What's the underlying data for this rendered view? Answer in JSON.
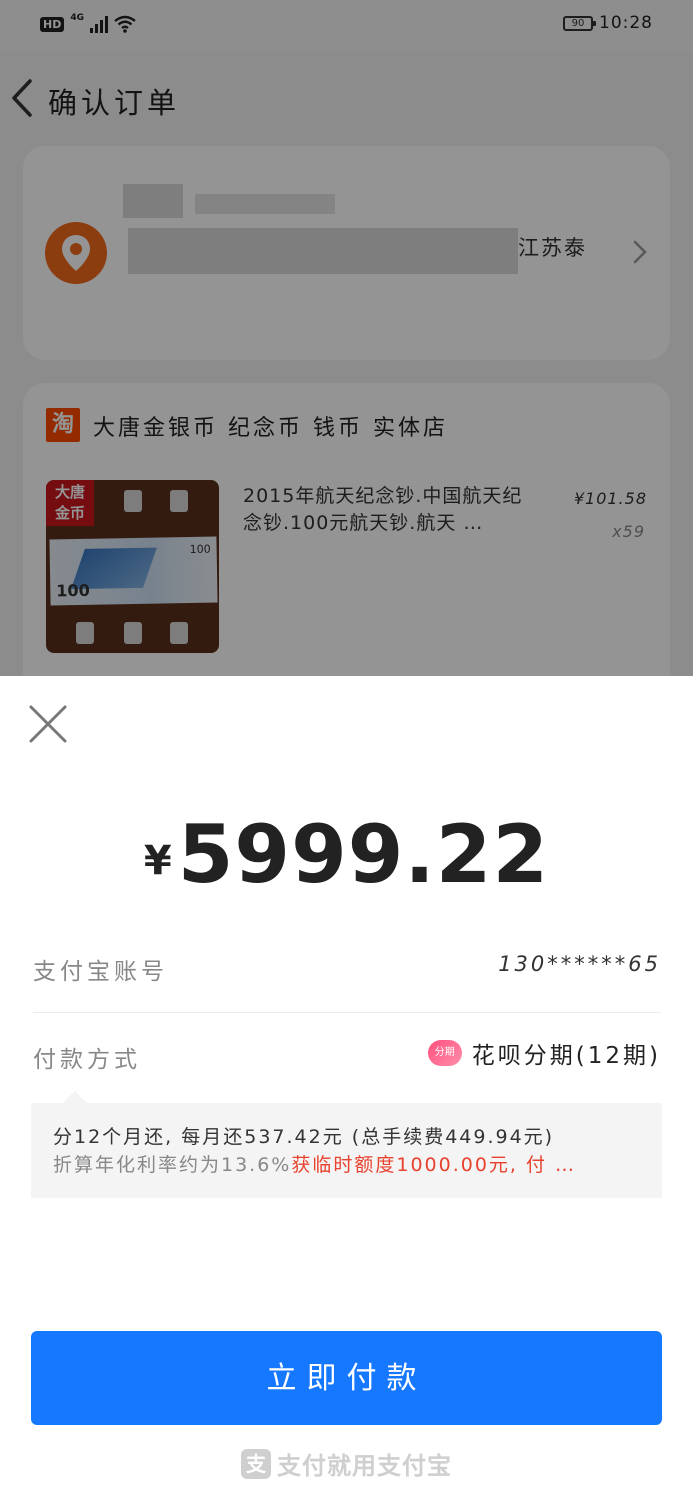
{
  "status_bar": {
    "hd": "HD",
    "network": "4G",
    "battery": "90",
    "time": "10:28"
  },
  "header": {
    "title": "确认订单"
  },
  "address": {
    "visible_tail": "江苏泰"
  },
  "shop": {
    "logo_char": "淘",
    "name": "大唐金银币 纪念币 钱币 实体店",
    "product": {
      "thumb_seal": "大唐\n金币",
      "thumb_denomination": "100",
      "title": "2015年航天纪念钞.中国航天纪念钞.100元航天钞.航天 …",
      "price": "¥101.58",
      "quantity": "x59"
    }
  },
  "payment": {
    "currency": "¥",
    "amount": "5999.22",
    "account_label": "支付宝账号",
    "account_value": "130******65",
    "method_label": "付款方式",
    "method_badge": "分期",
    "method_value": "花呗分期(12期)",
    "installment_line1": "分12个月还, 每月还537.42元 (总手续费449.94元)",
    "installment_line2_grey": "折算年化利率约为13.6%",
    "installment_line2_red": "获临时额度1000.00元, 付 …",
    "pay_button": "立即付款",
    "footer_logo": "支",
    "footer_text": "支付就用支付宝"
  },
  "colors": {
    "accent": "#1677ff",
    "location_pin": "#f26a1b",
    "taobao": "#ff4a00",
    "warning": "#e8422e"
  }
}
